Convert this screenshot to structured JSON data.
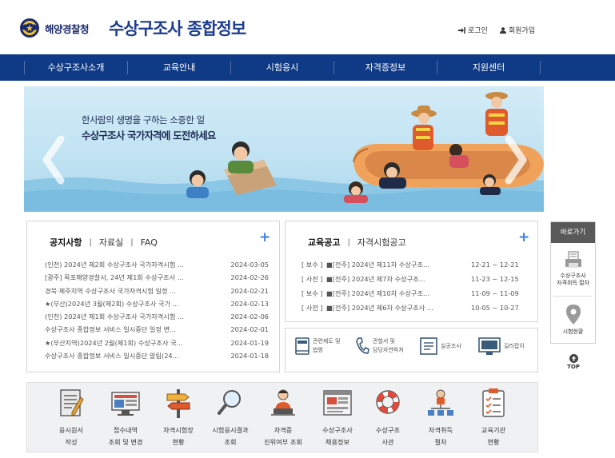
{
  "header": {
    "org_name": "해양경찰청",
    "site_title": "수상구조사 종합정보",
    "login_label": "로그인",
    "join_label": "회원가입"
  },
  "nav": {
    "items": [
      {
        "label": "수상구조사소개"
      },
      {
        "label": "교육안내"
      },
      {
        "label": "시험응시"
      },
      {
        "label": "자격증정보"
      },
      {
        "label": "지원센터"
      }
    ]
  },
  "banner": {
    "line1": "한사람의 생명을 구하는 소중한 일",
    "line2": "수상구조사 국가자격에 도전하세요"
  },
  "notice": {
    "tabs": [
      {
        "label": "공지사항"
      },
      {
        "label": "자료실"
      },
      {
        "label": "FAQ"
      }
    ],
    "separator": "|",
    "more_label": "+",
    "items": [
      {
        "title": "(인천) 2024년 제2회 수상구조사 국가자격시험 ...",
        "date": "2024-03-05"
      },
      {
        "title": "[광주] 목포해양경찰서, 24년 제1회 수상구조사 ...",
        "date": "2024-02-26"
      },
      {
        "title": "경북·제주지역 수상구조사 국가자격시험 일정 ...",
        "date": "2024-02-21"
      },
      {
        "title": "★(부산)2024년 3월(제2회) 수상구조사 국가 ...",
        "date": "2024-02-13"
      },
      {
        "title": "(인천) 2024년 제1회 수상구조사 국가자격시험 ...",
        "date": "2024-02-06"
      },
      {
        "title": "수상구조사 종합정보 서비스 일시중단 일정 변...",
        "date": "2024-02-01"
      },
      {
        "title": "★(부산지역)2024년 2월(제1회) 수상구조사 국...",
        "date": "2024-01-19"
      },
      {
        "title": "수상구조사 종합정보 서비스 일시중단 알림(24...",
        "date": "2024-01-18"
      }
    ]
  },
  "education": {
    "tabs": [
      {
        "label": "교육공고"
      },
      {
        "label": "자격시험공고"
      }
    ],
    "separator": "|",
    "more_label": "+",
    "items": [
      {
        "tag": "[ 보수 ]",
        "title": "■[전주] 2024년 제11차 수상구조...",
        "period": "12-21 ~ 12-21"
      },
      {
        "tag": "[ 사전 ]",
        "title": "■[전주] 2024년 제7차 수상구조...",
        "period": "11-23 ~ 12-15"
      },
      {
        "tag": "[ 보수 ]",
        "title": "■[전주] 2024년 제10차 수상구조...",
        "period": "11-09 ~ 11-09"
      },
      {
        "tag": "[ 사전 ]",
        "title": "■[전주] 2024년 제6차 수상구조사 ...",
        "period": "10-05 ~ 10-27"
      }
    ]
  },
  "quick_links": [
    {
      "line1": "관련제도 및",
      "line2": "법령",
      "icon": "book-icon"
    },
    {
      "line1": "관할서 및",
      "line2": "담당자연락처",
      "icon": "phone-icon"
    },
    {
      "line1": "실공조사",
      "line2": "",
      "icon": "document-icon"
    },
    {
      "line1": "길라잡이",
      "line2": "",
      "icon": "monitor-guide-icon"
    }
  ],
  "services": [
    {
      "line1": "응시원서",
      "line2": "작성",
      "icon": "application-form-icon"
    },
    {
      "line1": "접수내역",
      "line2": "조회 및 변경",
      "icon": "receipt-monitor-icon"
    },
    {
      "line1": "자격시험장",
      "line2": "현황",
      "icon": "signpost-icon"
    },
    {
      "line1": "시험응시결과",
      "line2": "조회",
      "icon": "magnifier-icon"
    },
    {
      "line1": "자격증",
      "line2": "진위여부 조회",
      "icon": "person-laptop-icon"
    },
    {
      "line1": "수상구조사",
      "line2": "채용정보",
      "icon": "web-page-icon"
    },
    {
      "line1": "수상구조",
      "line2": "사관",
      "icon": "lifebuoy-icon"
    },
    {
      "line1": "자격취득",
      "line2": "절차",
      "icon": "flowchart-icon"
    },
    {
      "line1": "교육기관",
      "line2": "현황",
      "icon": "clipboard-icon"
    }
  ],
  "side_menu": {
    "title": "바로가기",
    "items": [
      {
        "line1": "수상구조사",
        "line2": "자격취득 절차",
        "icon": "printer-doc-icon"
      },
      {
        "line1": "시험현황",
        "line2": "",
        "icon": "map-pin-icon"
      }
    ],
    "top_label": "TOP"
  },
  "colors": {
    "nav_bg": "#0f3a86",
    "title_blue": "#1c3c8f",
    "plus_blue": "#3c7fe1",
    "side_head": "#595959"
  }
}
